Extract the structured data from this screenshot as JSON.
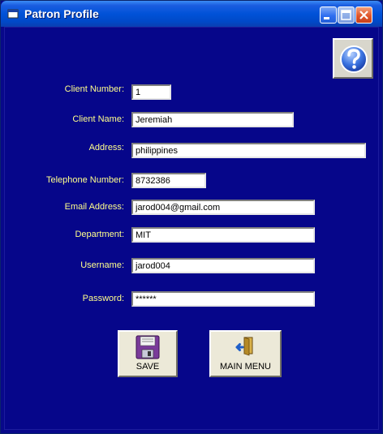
{
  "window": {
    "title": "Patron Profile"
  },
  "form": {
    "client_number": {
      "label": "Client Number:",
      "value": "1"
    },
    "client_name": {
      "label": "Client Name:",
      "value": "Jeremiah"
    },
    "address": {
      "label": "Address:",
      "value": "philippines"
    },
    "telephone": {
      "label": "Telephone Number:",
      "value": "8732386"
    },
    "email": {
      "label": "Email Address:",
      "value": "jarod004@gmail.com"
    },
    "department": {
      "label": "Department:",
      "value": "MIT"
    },
    "username": {
      "label": "Username:",
      "value": "jarod004"
    },
    "password": {
      "label": "Password:",
      "value": "******"
    }
  },
  "buttons": {
    "save": "SAVE",
    "main_menu": "MAIN MENU"
  },
  "icons": {
    "help": "help-question-icon",
    "save": "floppy-disk-icon",
    "main_menu": "exit-door-icon"
  },
  "colors": {
    "form_background": "#06068a",
    "label_text": "#ffff8c",
    "titlebar": "#0052d8"
  }
}
